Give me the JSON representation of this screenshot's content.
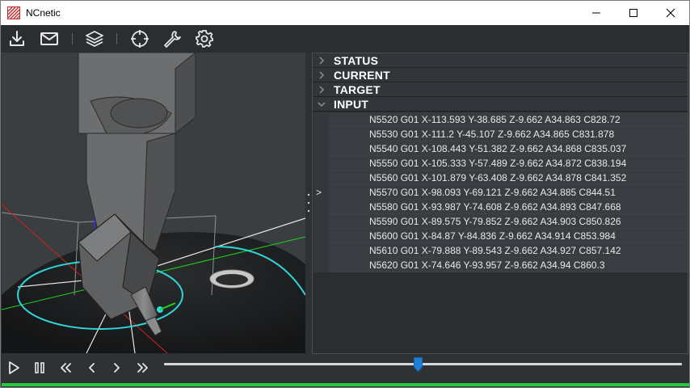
{
  "window": {
    "title": "NCnetic",
    "icons": {
      "app": "hatched-logo-icon",
      "minimize": "minimize-icon",
      "maximize": "maximize-icon",
      "close": "close-icon"
    }
  },
  "toolbar": {
    "buttons": [
      "download-icon",
      "mail-icon",
      "layers-icon",
      "crosshair-icon",
      "wrench-icon",
      "gear-icon"
    ]
  },
  "viewport": {
    "background": "#3a3d40"
  },
  "panel": {
    "sections": [
      {
        "label": "STATUS",
        "expanded": false
      },
      {
        "label": "CURRENT",
        "expanded": false
      },
      {
        "label": "TARGET",
        "expanded": false
      },
      {
        "label": "INPUT",
        "expanded": true
      }
    ],
    "input_rows": [
      {
        "marker": "",
        "text": "N5520 G01 X-113.593 Y-38.685 Z-9.662 A34.863  C828.72"
      },
      {
        "marker": "",
        "text": "N5530 G01 X-111.2 Y-45.107 Z-9.662 A34.865  C831.878"
      },
      {
        "marker": "",
        "text": "N5540 G01 X-108.443 Y-51.382 Z-9.662 A34.868  C835.037"
      },
      {
        "marker": "",
        "text": "N5550 G01 X-105.333 Y-57.489 Z-9.662 A34.872  C838.194"
      },
      {
        "marker": "",
        "text": "N5560 G01 X-101.879 Y-63.408 Z-9.662 A34.878  C841.352"
      },
      {
        "marker": ">",
        "text": "N5570 G01 X-98.093 Y-69.121 Z-9.662 A34.885  C844.51"
      },
      {
        "marker": "",
        "text": "N5580 G01 X-93.987 Y-74.608 Z-9.662 A34.893  C847.668"
      },
      {
        "marker": "",
        "text": "N5590 G01 X-89.575 Y-79.852 Z-9.662 A34.903  C850.826"
      },
      {
        "marker": "",
        "text": "N5600 G01 X-84.87 Y-84.836 Z-9.662 A34.914  C853.984"
      },
      {
        "marker": "",
        "text": "N5610 G01 X-79.888 Y-89.543 Z-9.662 A34.927  C857.142"
      },
      {
        "marker": "",
        "text": "N5620 G01 X-74.646 Y-93.957 Z-9.662 A34.94  C860.3"
      }
    ]
  },
  "transport": {
    "buttons": [
      "play-icon",
      "pause-icon",
      "rewind-icon",
      "step-back-icon",
      "step-forward-icon",
      "fast-forward-icon"
    ],
    "slider_position": 0.49,
    "accent": "#1e7fd8",
    "progress_fraction": 1.0,
    "progress_color": "#27c93f"
  }
}
